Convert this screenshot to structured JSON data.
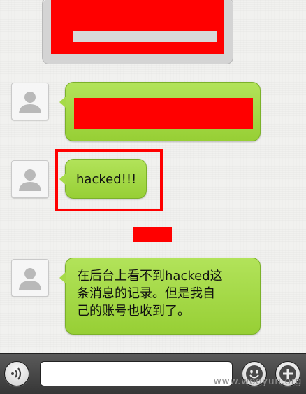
{
  "messages": [
    {
      "type": "image",
      "redacted": true
    },
    {
      "sender": "self",
      "redacted": true
    },
    {
      "sender": "self",
      "text": "hacked!!!",
      "highlighted": true
    },
    {
      "sender": "self",
      "lines": [
        "在后台上看不到hacked这",
        "条消息的记录。但是我自",
        "己的账号也收到了。"
      ]
    }
  ],
  "toolbar": {
    "voice_icon": "voice-icon",
    "emoji_icon": "smiley-icon",
    "plus_icon": "plus-icon",
    "input_value": ""
  },
  "watermark": "www.wooyun.org",
  "colors": {
    "bubble": "#a6da48",
    "redaction": "#ff0000",
    "toolbar": "#454545"
  }
}
